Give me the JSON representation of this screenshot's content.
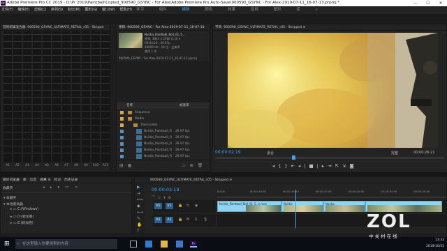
{
  "window": {
    "title": "Adobe Premiere Pro CC 2019 - D:\\Pr 2019\\Paintball\\Copied_900590_GSYNC - For Alex\\Adobe Premiere Pro Auto-Save\\900590_GSYNC - For Alex-2019-07-11_16-07-13.prproj *",
    "app_icon": "Pr",
    "controls": [
      "—",
      "☐",
      "✕"
    ]
  },
  "menu": [
    "文件(F)",
    "编辑(E)",
    "剪辑(C)",
    "序列(S)",
    "标记(M)",
    "图形(G)",
    "窗口(W)",
    "帮助(H)"
  ],
  "workspaces": [
    "学习",
    "组件",
    "编辑",
    "颜色",
    "效果",
    "音频",
    "图形",
    "库",
    "»"
  ],
  "active_workspace_index": 2,
  "mixer": {
    "title": "音频剪辑混合器: 900590_GSYNC_ULTIMATE_RETAIL_r05 - Strippd",
    "channels": [
      "A1",
      "A2",
      "A3",
      "A4",
      "A5",
      "A6",
      "A7",
      "A8",
      "A9",
      "A10",
      "A11"
    ]
  },
  "project": {
    "title": "项目: 900590_GSYNC - For Alex-2019-07-11_16-07-13",
    "clip_name": "Nvidia_Paintball_Roll_01_5...",
    "clip_res": "视频, 3840 x 2160 (1.0) ▾",
    "clip_dur": "00:00:20:, 29.97p",
    "clip_audio": "48000 Hz - 16 位 - 立体声",
    "clip_used": "使用 1 次",
    "path": "900590_GSYNC - For Alex-2019-07-11_16-07-13.prproj",
    "col_name": "名称",
    "col_rate": "帧速率",
    "rows": [
      {
        "label": "Sequence",
        "kind": "folder",
        "indent": 1
      },
      {
        "label": "Media",
        "kind": "folder",
        "indent": 1
      },
      {
        "label": "Transcodes",
        "kind": "folder",
        "indent": 2
      },
      {
        "label": "Nvidia_Paintball_R",
        "kind": "clip",
        "fps": "29.97 fps"
      },
      {
        "label": "Nvidia_Paintball_R",
        "kind": "clip",
        "fps": "29.97 fps"
      },
      {
        "label": "Nvidia_Paintball_R",
        "kind": "clip",
        "fps": "29.97 fps"
      },
      {
        "label": "Nvidia_Paintball_R",
        "kind": "clip",
        "fps": "29.97 fps"
      },
      {
        "label": "Nvidia_Paintball_R",
        "kind": "clip",
        "fps": "29.97 fps"
      }
    ]
  },
  "program": {
    "title": "节目: 900590_GSYNC_ULTIMATE_RETAIL_r05 - Stripped ≡",
    "timecode_left": "00:00:02:19",
    "fit": "适合",
    "quality": "完整",
    "timecode_right": "00:00:26:21",
    "transport": [
      "◂",
      "{",
      "}",
      "⇤",
      "◂|",
      "■",
      "|▸",
      "⇥",
      "⇱",
      "⇲",
      "◙"
    ],
    "playhead_fraction": 0.34
  },
  "effects": {
    "tabs": [
      "媒体浏览器",
      "库",
      "信息",
      "效果 ≡",
      "标记",
      "历史记录"
    ],
    "location_label": "收藏夹",
    "items": [
      "收藏夹",
      "本地驱动器",
      "C:(Windows)",
      "D:(新加卷)",
      "E:(新加卷)"
    ]
  },
  "timeline": {
    "title": "900590_GSYNC_ULTIMATE_RETAIL_r05 - Stripped ≡",
    "timecode": "00:00:02:19",
    "ruler": [
      "00:00",
      "00:00:19:00",
      "00:00:19:23",
      "00:00:20:00",
      "00:00:44:00",
      "00:00:54:00",
      "00:00:49:00"
    ],
    "tracks": [
      "V1",
      "A1"
    ],
    "clip_label": "Nvidia_Paintball_Roll_01_5...t.mov",
    "clip_label2": "Nvidia_",
    "clip_label3": "Nvidia_"
  },
  "taskbar": {
    "search_placeholder": "在这里输入你要搜索的内容",
    "clock": "13:33",
    "date": "2019/10/31",
    "watermark": "ZOL",
    "watermark_sub": "中 关 村 在 线"
  },
  "colors": {
    "accent": "#3fa3f2",
    "timecode": "#3fa3f2",
    "clip_video": "#8fd3ee",
    "folder": "#b58b3e"
  }
}
